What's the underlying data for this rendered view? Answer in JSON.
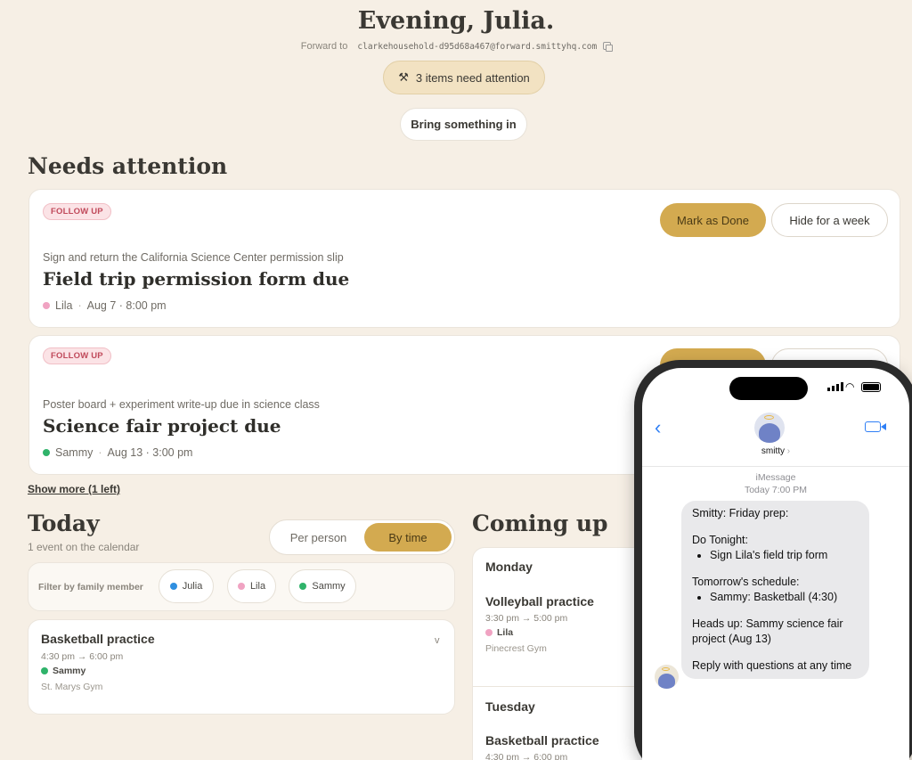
{
  "header": {
    "greeting": "Evening, Julia.",
    "forward_label": "Forward to",
    "forward_address": "clarkehousehold-d95d68a467@forward.smittyhq.com",
    "attention_badge": "3 items need attention",
    "bring_button": "Bring something in"
  },
  "needs_attention": {
    "title": "Needs attention",
    "items": [
      {
        "tag": "FOLLOW UP",
        "subtitle": "Sign and return the California Science Center permission slip",
        "title": "Field trip permission form due",
        "person": "Lila",
        "person_color": "#f0a3c2",
        "when": "Aug 7 · 8:00 pm",
        "done_label": "Mark as Done",
        "hide_label": "Hide for a week"
      },
      {
        "tag": "FOLLOW UP",
        "subtitle": "Poster board + experiment write-up due in science class",
        "title": "Science fair project due",
        "person": "Sammy",
        "person_color": "#2fb36a",
        "when": "Aug 13 · 3:00 pm"
      }
    ],
    "show_more": "Show more (1 left)"
  },
  "today": {
    "title": "Today",
    "subtitle": "1 event on the calendar",
    "toggle_per_person": "Per person",
    "toggle_by_time": "By time",
    "filter_label": "Filter by family member",
    "members": [
      {
        "name": "Julia",
        "color": "#2f8fe0"
      },
      {
        "name": "Lila",
        "color": "#f0a3c2"
      },
      {
        "name": "Sammy",
        "color": "#2fb36a"
      }
    ],
    "event": {
      "title": "Basketball practice",
      "time": "4:30 pm → 6:00 pm",
      "who": "Sammy",
      "location": "St. Marys Gym"
    }
  },
  "coming_up": {
    "title": "Coming up",
    "days": [
      {
        "day": "Monday",
        "event_title": "Volleyball practice",
        "time": "3:30 pm → 5:00 pm",
        "who": "Lila",
        "location": "Pinecrest Gym"
      },
      {
        "day": "Tuesday",
        "event_title": "Basketball practice",
        "time": "4:30 pm → 6:00 pm"
      }
    ]
  },
  "phone": {
    "contact": "smitty",
    "service": "iMessage",
    "timestamp": "Today 7:00 PM",
    "message": {
      "line1": "Smitty: Friday prep:",
      "tonight_label": "Do Tonight:",
      "tonight_item": "Sign Lila's field trip form",
      "schedule_label": "Tomorrow's schedule:",
      "schedule_item": "Sammy: Basketball (4:30)",
      "heads_up": "Heads up: Sammy science fair project (Aug 13)",
      "reply": "Reply with questions at any time"
    }
  }
}
